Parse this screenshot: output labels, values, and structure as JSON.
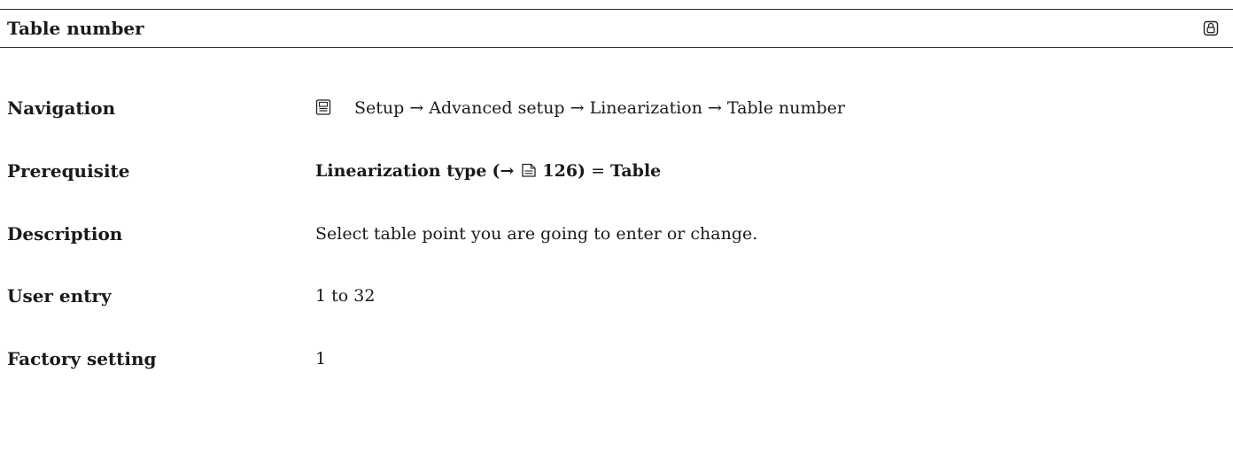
{
  "header": {
    "title": "Table number",
    "lock_icon": "lock-icon"
  },
  "rows": {
    "navigation": {
      "label": "Navigation",
      "icon": "menu-icon",
      "path": "Setup → Advanced setup → Linearization → Table number"
    },
    "prerequisite": {
      "label": "Prerequisite",
      "param": "Linearization type",
      "open": "(→",
      "ref_icon": "page-ref-icon",
      "page": "126)",
      "eq": "=",
      "value": "Table"
    },
    "description": {
      "label": "Description",
      "value": "Select table point you are going to enter or change."
    },
    "user_entry": {
      "label": "User entry",
      "value": "1 to 32"
    },
    "factory_setting": {
      "label": "Factory setting",
      "value": "1"
    }
  }
}
